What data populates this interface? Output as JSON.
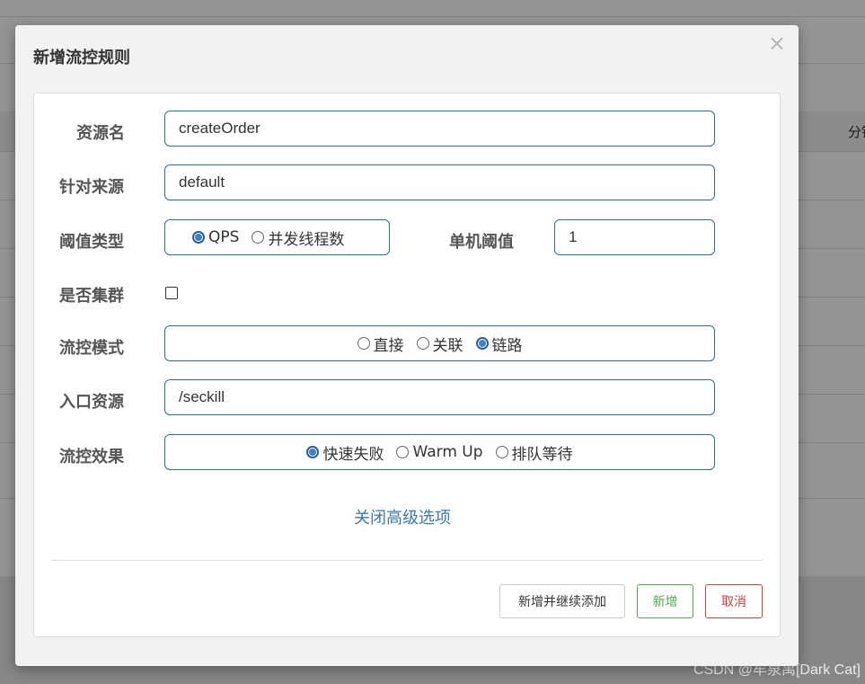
{
  "background": {
    "column_label": "分钟",
    "watermark": "CSDN @牟泉禹[Dark Cat]"
  },
  "modal": {
    "title": "新增流控规则",
    "close_glyph": "×",
    "resource_name": {
      "label": "资源名",
      "value": "createOrder"
    },
    "limit_app": {
      "label": "针对来源",
      "value": "default"
    },
    "threshold_type": {
      "label": "阈值类型",
      "options": [
        "QPS",
        "并发线程数"
      ],
      "selected": "QPS"
    },
    "single_threshold": {
      "label": "单机阈值",
      "value": "1"
    },
    "cluster": {
      "label": "是否集群",
      "checked": false
    },
    "flow_mode": {
      "label": "流控模式",
      "options": [
        "直接",
        "关联",
        "链路"
      ],
      "selected": "链路"
    },
    "entry_resource": {
      "label": "入口资源",
      "value": "/seckill"
    },
    "control_effect": {
      "label": "流控效果",
      "options": [
        "快速失败",
        "Warm Up",
        "排队等待"
      ],
      "selected": "快速失败"
    },
    "advanced_link": "关闭高级选项",
    "buttons": {
      "add_continue": "新增并继续添加",
      "add": "新增",
      "cancel": "取消"
    }
  },
  "colors": {
    "input_border": "#2e6da4",
    "link": "#3a78b8",
    "success": "#4cae4c",
    "danger": "#d43f3a"
  }
}
